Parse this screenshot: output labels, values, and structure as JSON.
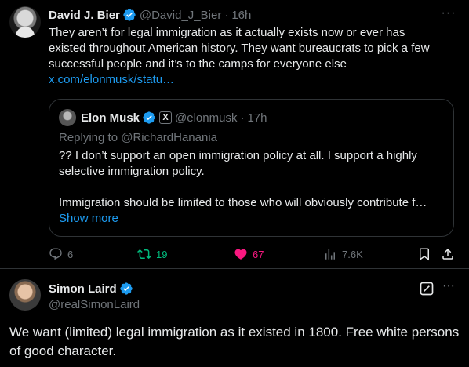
{
  "tweet1": {
    "name": "David J. Bier",
    "handle": "@David_J_Bier",
    "time": "16h",
    "text_lines": [
      "They aren’t for legal immigration as it actually exists now or ever has",
      "existed throughout American history. They want bureaucrats to pick a few",
      "successful people and it’s to the camps for everyone else"
    ],
    "link": "x.com/elonmusk/statu…",
    "more": "···",
    "quote": {
      "name": "Elon Musk",
      "badge": "X",
      "handle": "@elonmusk",
      "time": "17h",
      "replying_to": "Replying to @RichardHanania",
      "para1": "?? I don’t support an open immigration policy at all. I support a highly selective immigration policy.",
      "para2": "Immigration should be limited to those who will obviously contribute f…",
      "show_more": "Show more"
    },
    "actions": {
      "replies": "6",
      "retweets": "19",
      "likes": "67",
      "views": "7.6K"
    }
  },
  "tweet2": {
    "name": "Simon Laird",
    "handle": "@realSimonLaird",
    "more": "···",
    "text": "We want (limited) legal immigration as it existed in 1800.  Free white persons of good character."
  },
  "colors": {
    "background": "#000000",
    "text": "#e7e9ea",
    "muted": "#71767b",
    "link": "#1d9bf0",
    "verified": "#1d9bf0",
    "retweet": "#00ba7c",
    "like": "#f91880",
    "border": "#2f3336"
  }
}
